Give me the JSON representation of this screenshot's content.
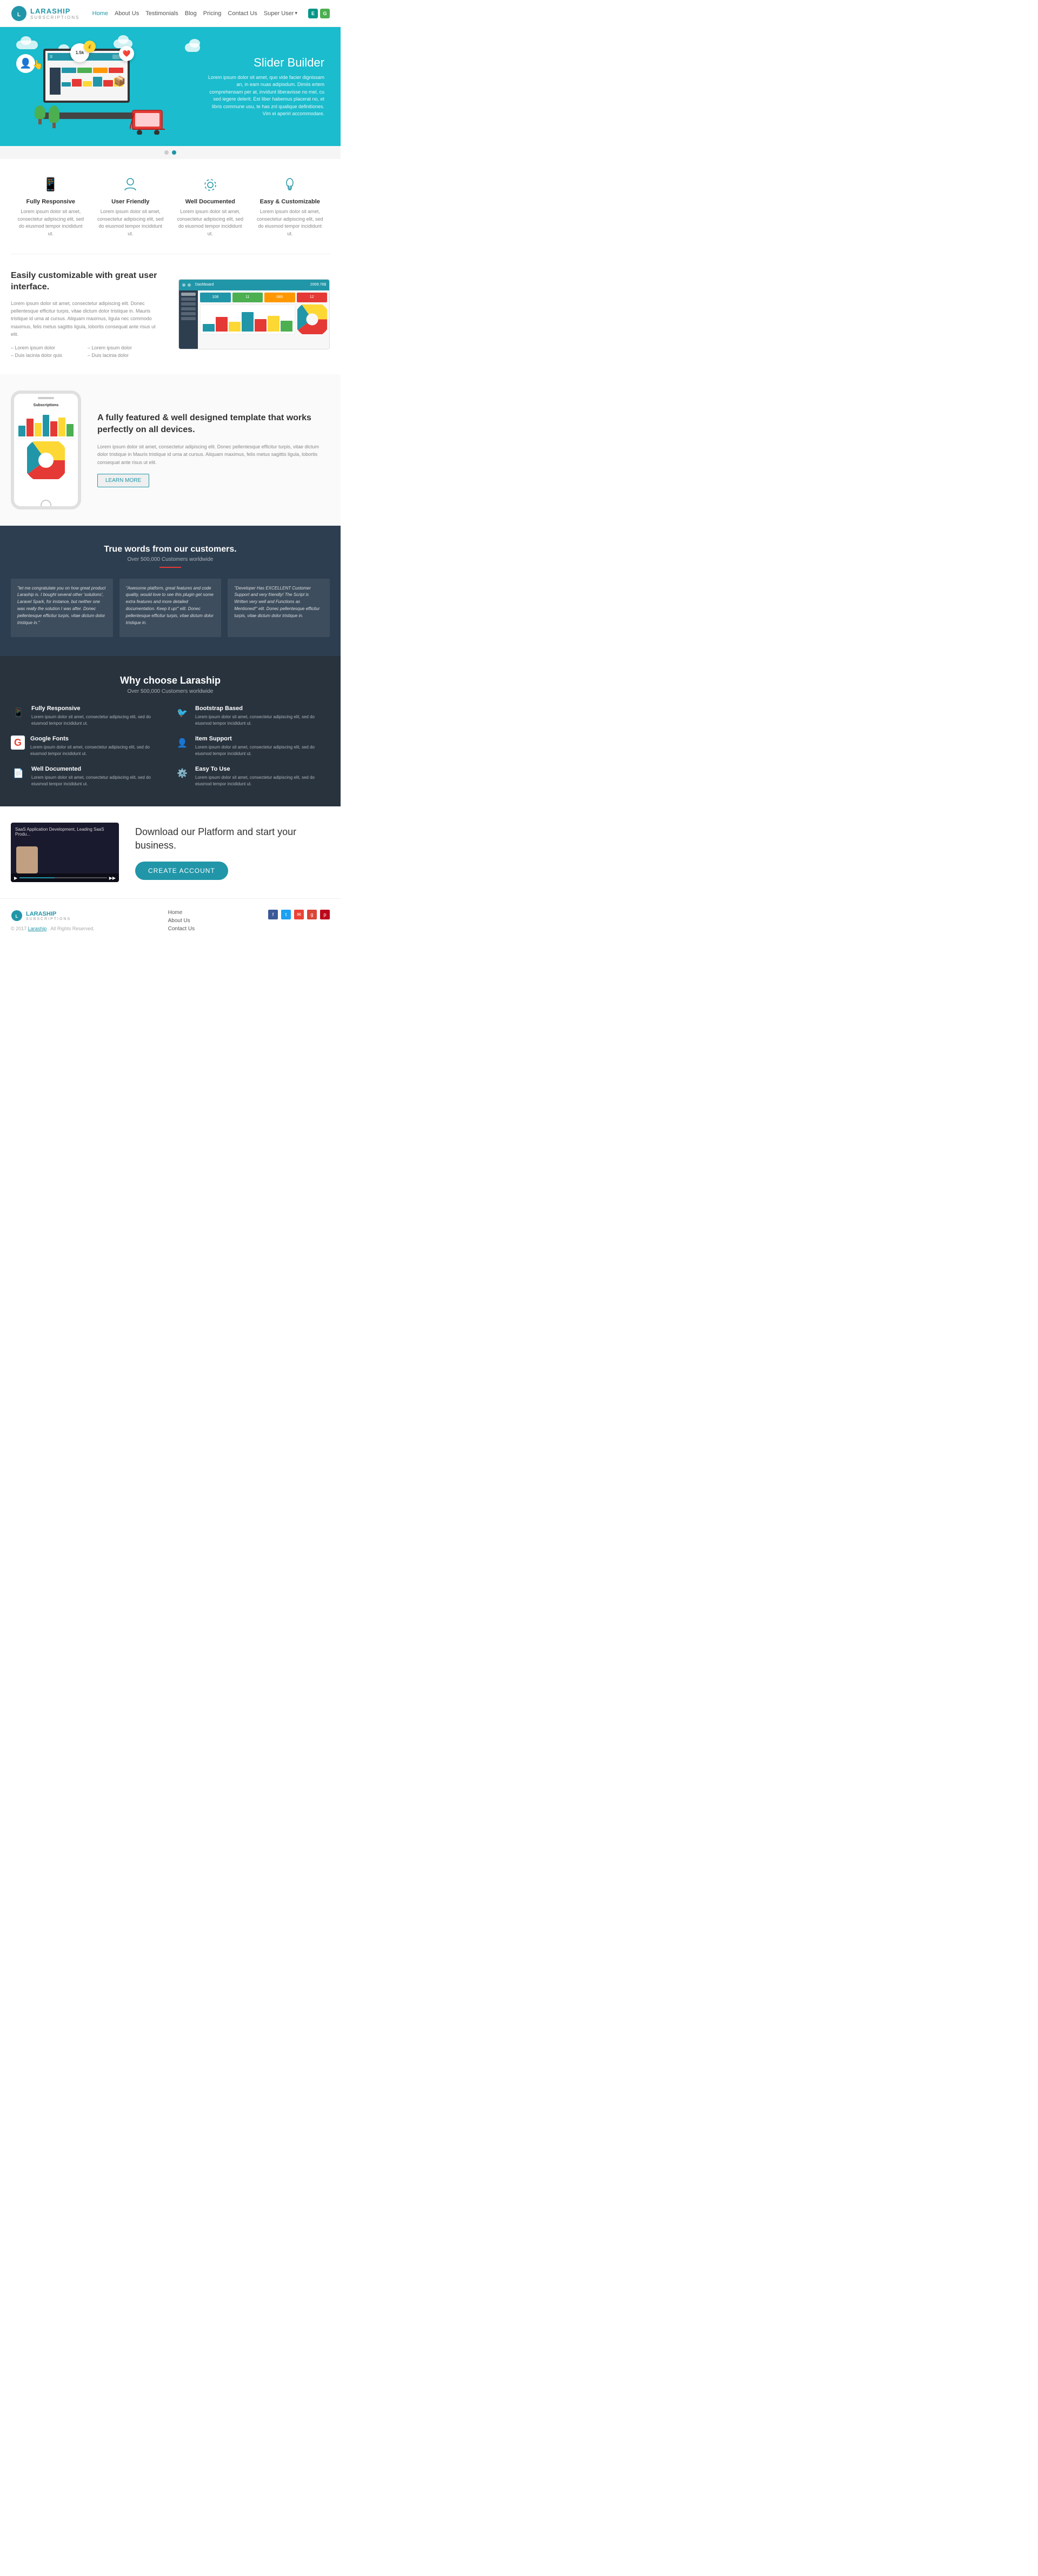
{
  "navbar": {
    "brand_name": "LARASHIP",
    "brand_sub": "SUBSCRIPTIONS",
    "links": [
      "Home",
      "About Us",
      "Testimonials",
      "Blog",
      "Pricing",
      "Contact Us"
    ],
    "active_link": "Home",
    "super_user": "Super User",
    "btn1": "E",
    "btn2": "G"
  },
  "hero": {
    "title": "Slider Builder",
    "text": "Lorem ipsum dolor sit amet, quo vide facier dignissam an, in eam nuas adipisdum. Dimiis ertem comprehensam per at, invidunt liberavisse no mel, cu sed iegere delerit. Est liber habemus placerat no, et libris commune usu, te has znl qualique definitiones. Vim ei aperiri accommodare."
  },
  "features": [
    {
      "icon": "📱",
      "title": "Fully Responsive",
      "text": "Lorem ipsum dolor sit amet, consectetur adipiscing elit, sed do eiusmod tempor incididunt ut."
    },
    {
      "icon": "👤",
      "title": "User Friendly",
      "text": "Lorem ipsum dolor sit amet, consectetur adipiscing elit, sed do eiusmod tempor incididunt ut."
    },
    {
      "icon": "⚙️",
      "title": "Well Documented",
      "text": "Lorem ipsum dolor sit amet, consectetur adipiscing elit, sed do eiusmod tempor incididunt ut."
    },
    {
      "icon": "💡",
      "title": "Easy & Customizable",
      "text": "Lorem ipsum dolor sit amet, consectetur adipiscing elit, sed do eiusmod tempor incididunt ut."
    }
  ],
  "custom_section": {
    "title": "Easily customizable with great user interface.",
    "desc": "Lorem ipsum dolor sit amet, consectetur adipiscing elit. Donec pellentesque efficitur turpis, vitae dictum dolor tristique in. Mauris tristique id uma at cursus. Aliquam maximus, ligula nec commodo maximus, felis metus sagittis ligula, lobortis consequat ante risus ut elit.",
    "list": [
      "Lorem ipsum dolor",
      "Lorem ipsum dolor",
      "Duis lacinia dolor quis",
      "Duis lacinia dolor"
    ]
  },
  "mobile_section": {
    "title": "A fully featured & well designed template that works perfectly on all devices.",
    "desc": "Lorem ipsum dolor sit amet, consectetur adipiscing elit. Donec pellentesque efficitur turpis, vitae dictum dolor tristique in Mauris tristique id uma at cursus. Aliquam maximus, felis metus sagittis ligula, lobortis consequat ante risus ut elit.",
    "btn": "LEARN MORE"
  },
  "testimonials": {
    "title": "True words from our customers.",
    "sub": "Over 500,000 Customers worldwide",
    "items": [
      {
        "text": "\"let me congratulate you on how great product Laraship is. I bought several other 'solutions', Laravel Spark, for instance, but neither one was really the solution I was after. Donec pellentesque efficitur turpis, vitae dictum dolor tristique in.\"",
        "author": ""
      },
      {
        "text": "\"Awesome platform, great features and code quality, would love to see this plugin get some extra features and more detailed documentation. Keep it up!\" elit. Donec pellentesque efficitur turpis, vitae dictum dolor tristique in.",
        "author": ""
      },
      {
        "text": "\"Developer Has EXCELLENT Customer Support and very friendly! The Script is Written very well and Functions as Mentioned!\" elit. Donec pellentesque efficitur turpis, vitae dictum dolor tristique in.",
        "author": ""
      }
    ]
  },
  "why_section": {
    "title": "Why choose Laraship",
    "sub": "Over 500,000 Customers worldwide",
    "items": [
      {
        "icon": "📱",
        "title": "Fully Responsive",
        "desc": "Lorem ipsum dolor sit amet, consectetur adipiscing elit, sed do eiusmod tempor incididunt ut."
      },
      {
        "icon": "🐦",
        "title": "Bootstrap Based",
        "desc": "Lorem ipsum dolor sit amet, consectetur adipiscing elit, sed do eiusmod tempor incididunt ut."
      },
      {
        "icon": "G",
        "title": "Google Fonts",
        "desc": "Lorem ipsum dolor sit amet, consectetur adipiscing elit, sed do eiusmod tempor incididunt ut."
      },
      {
        "icon": "👤",
        "title": "Item Support",
        "desc": "Lorem ipsum dolor sit amet, consectetur adipiscing elit, sed do eiusmod tempor incididunt ut."
      },
      {
        "icon": "📄",
        "title": "Well Documented",
        "desc": "Lorem ipsum dolor sit amet, consectetur adipiscing elit, sed do eiusmod tempor incididunt ut."
      },
      {
        "icon": "✓",
        "title": "Easy To Use",
        "desc": "Lorem ipsum dolor sit amet, consectetur adipiscing elit, sed do eiusmod tempor incididunt ut."
      }
    ]
  },
  "download_section": {
    "video_text": "SaaS Application Development, Leading SaaS Produ...",
    "title": "Download our Platform and start your business.",
    "btn": "CREATE ACCOUNT"
  },
  "footer": {
    "brand_name": "LARASHIP",
    "brand_sub": "SUBSCRIPTIONS",
    "links": [
      "Home",
      "About Us",
      "Contact Us"
    ],
    "copyright": "© 2017",
    "company": "Laraship",
    "rights": ". All Rights Reserved.",
    "social": [
      "f",
      "t",
      "✉",
      "g+",
      "p"
    ]
  }
}
